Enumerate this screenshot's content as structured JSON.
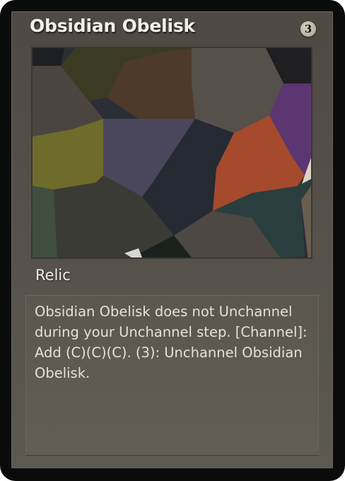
{
  "card": {
    "name": "Obsidian Obelisk",
    "cost": "3",
    "type": "Relic",
    "rules_text": "Obsidian Obelisk does not Unchannel during your Unchannel step. [Channel]: Add (C)(C)(C). (3): Unchannel Obsidian Obelisk.",
    "colors": {
      "border": "#0b0b0b",
      "frame": "#55514a",
      "text_box": "#5f5b52",
      "title_text": "#f1efe9"
    }
  }
}
